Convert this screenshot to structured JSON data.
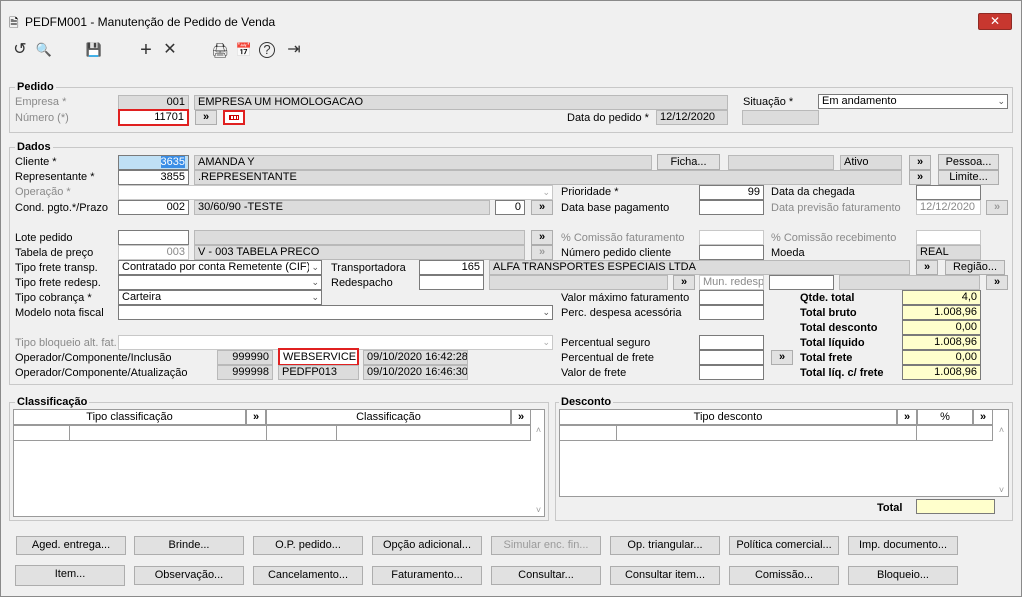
{
  "window": {
    "title": "PEDFM001 - Manutenção de Pedido de Venda",
    "close": "✕"
  },
  "toolbar": {
    "undo": "↺",
    "search": "🔍",
    "save": "💾",
    "add": "+",
    "remove": "✕",
    "print": "🖨",
    "calendar": "📅",
    "help": "?",
    "exit": "⇥"
  },
  "pedido": {
    "section": "Pedido",
    "empresa_label": "Empresa *",
    "empresa_code": "001",
    "empresa_name": "EMPRESA UM HOMOLOGACAO",
    "numero_label": "Número (*)",
    "numero": "11701",
    "situacao_label": "Situação *",
    "situacao": "Em andamento",
    "data_label": "Data do pedido *",
    "data": "12/12/2020"
  },
  "dados": {
    "section": "Dados",
    "cliente_label": "Cliente *",
    "cliente_code": "3635",
    "cliente_name": "AMANDA Y",
    "ficha": "Ficha...",
    "cliente_status": "Ativo",
    "pessoa": "Pessoa...",
    "representante_label": "Representante *",
    "representante_code": "3855",
    "representante_name": ".REPRESENTANTE",
    "limite": "Limite...",
    "operacao_label": "Operação *",
    "prioridade_label": "Prioridade *",
    "prioridade": "99",
    "data_chegada_label": "Data da chegada",
    "cond_label": "Cond. pgto.*/Prazo",
    "cond_code": "002",
    "cond_name": "30/60/90 -TESTE",
    "prazo": "0",
    "data_base_label": "Data base pagamento",
    "data_prev_label": "Data previsão faturamento",
    "data_prev": "12/12/2020",
    "lote_label": "Lote pedido",
    "comissao_fat_label": "% Comissão faturamento",
    "comissao_rec_label": "% Comissão recebimento",
    "tabela_label": "Tabela de preço",
    "tabela_code": "003",
    "tabela_name": "V         - 003 TABELA PRECO",
    "num_cliente_label": "Número pedido cliente",
    "moeda_label": "Moeda",
    "moeda": "REAL",
    "frete_transp_label": "Tipo frete transp.",
    "frete_transp": "Contratado por conta Remetente (CIF)",
    "transportadora_label": "Transportadora",
    "transportadora_code": "165",
    "transportadora_name": "ALFA TRANSPORTES ESPECIAIS LTDA",
    "regiao": "Região...",
    "frete_redesp_label": "Tipo frete redesp.",
    "redespacho_label": "Redespacho",
    "mun_redesp": "Mun. redesp.",
    "cobranca_label": "Tipo cobrança *",
    "cobranca": "Carteira",
    "valor_max_label": "Valor máximo faturamento",
    "modelo_label": "Modelo nota fiscal",
    "perc_desp_label": "Perc. despesa acessória",
    "bloqueio_label": "Tipo bloqueio alt. fat.",
    "perc_seguro_label": "Percentual seguro",
    "op_incl_label": "Operador/Componente/Inclusão",
    "op_incl_code": "999990",
    "op_incl_name": "WEBSERVICE",
    "op_incl_date": "09/10/2020 16:42:28",
    "perc_frete_label": "Percentual de frete",
    "op_atu_label": "Operador/Componente/Atualização",
    "op_atu_code": "999998",
    "op_atu_name": "PEDFP013",
    "op_atu_date": "09/10/2020 16:46:30",
    "valor_frete_label": "Valor de frete"
  },
  "totals": {
    "qtde_label": "Qtde. total",
    "qtde": "4,0",
    "bruto_label": "Total bruto",
    "bruto": "1.008,96",
    "desconto_label": "Total desconto",
    "desconto": "0,00",
    "liquido_label": "Total líquido",
    "liquido": "1.008,96",
    "frete_label": "Total frete",
    "frete": "0,00",
    "liq_frete_label": "Total líq. c/ frete",
    "liq_frete": "1.008,96"
  },
  "classificacao": {
    "section": "Classificação",
    "col1": "Tipo classificação",
    "col2": "Classificação"
  },
  "desconto": {
    "section": "Desconto",
    "col1": "Tipo desconto",
    "col2": "%",
    "total_label": "Total"
  },
  "buttons": {
    "arrow": "»",
    "aged": "Aged. entrega...",
    "brinde": "Brinde...",
    "op_pedido": "O.P. pedido...",
    "opcao": "Opção adicional...",
    "simular": "Simular enc. fin...",
    "triangular": "Op. triangular...",
    "politica": "Política comercial...",
    "imp": "Imp. documento...",
    "item": "Item...",
    "observacao": "Observação...",
    "cancelamento": "Cancelamento...",
    "faturamento": "Faturamento...",
    "consultar": "Consultar...",
    "consultar_item": "Consultar item...",
    "comissao": "Comissão...",
    "bloqueio": "Bloqueio..."
  }
}
